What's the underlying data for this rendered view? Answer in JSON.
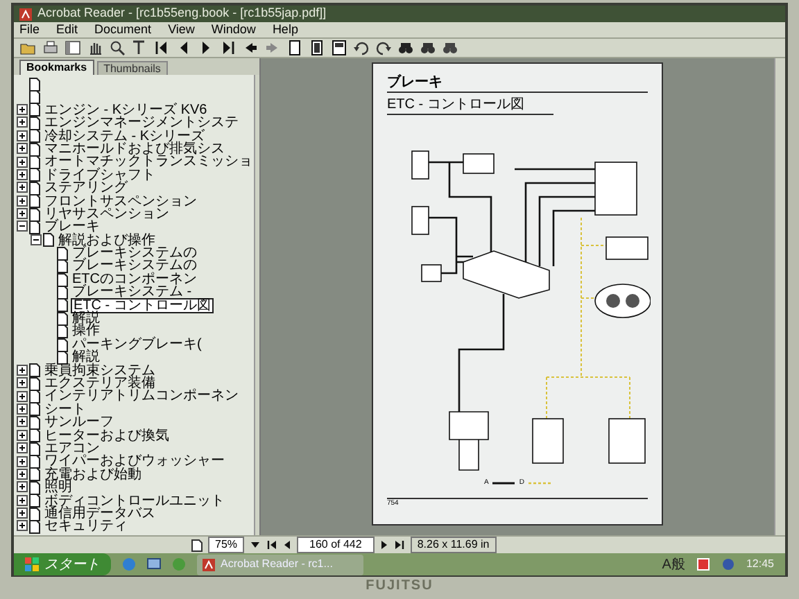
{
  "window": {
    "title": "Acrobat Reader - [rc1b55eng.book - [rc1b55jap.pdf]]"
  },
  "menu": [
    "File",
    "Edit",
    "Document",
    "View",
    "Window",
    "Help"
  ],
  "panel_tabs": [
    {
      "label": "Bookmarks",
      "selected": true
    },
    {
      "label": "Thumbnails",
      "selected": false
    }
  ],
  "bookmarks": [
    {
      "selected": false
    },
    {
      "selected": false
    },
    {
      "label": "エンジン - Kシリーズ KV6",
      "expanded": false,
      "selected": false
    },
    {
      "label": "エンジンマネージメントシステ",
      "expanded": false,
      "selected": false
    },
    {
      "label": "冷却システム - Kシリーズ",
      "expanded": false,
      "selected": false
    },
    {
      "label": "マニホールドおよび排気シス",
      "expanded": false,
      "selected": false
    },
    {
      "label": "オートマチックトランスミッショ",
      "expanded": false,
      "selected": false
    },
    {
      "label": "ドライブシャフト",
      "expanded": false,
      "selected": false
    },
    {
      "label": "ステアリング",
      "expanded": false,
      "selected": false
    },
    {
      "label": "フロントサスペンション",
      "expanded": false,
      "selected": false
    },
    {
      "label": "リヤサスペンション",
      "expanded": false,
      "selected": false
    },
    {
      "label": "ブレーキ",
      "expanded": true,
      "selected": false,
      "children": [
        {
          "label": "解説および操作",
          "expanded": true,
          "selected": false,
          "children": [
            {
              "label": "ブレーキシステムの",
              "selected": false
            },
            {
              "label": "ブレーキシステムの",
              "selected": false
            },
            {
              "label": "ETCのコンポーネン",
              "selected": false
            },
            {
              "label": "ブレーキシステム -",
              "selected": false
            },
            {
              "label": "ETC - コントロール図",
              "selected": true
            },
            {
              "label": "解説",
              "selected": false
            },
            {
              "label": "操作",
              "selected": false
            },
            {
              "label": "パーキングブレーキ(",
              "selected": false
            },
            {
              "label": "解説",
              "selected": false
            }
          ]
        }
      ]
    },
    {
      "label": "乗員拘束システム",
      "expanded": false,
      "selected": false
    },
    {
      "label": "エクステリア装備",
      "expanded": false,
      "selected": false
    },
    {
      "label": "インテリアトリムコンポーネン",
      "expanded": false,
      "selected": false
    },
    {
      "label": "シート",
      "expanded": false,
      "selected": false
    },
    {
      "label": "サンルーフ",
      "expanded": false,
      "selected": false
    },
    {
      "label": "ヒーターおよび換気",
      "expanded": false,
      "selected": false
    },
    {
      "label": "エアコン",
      "expanded": false,
      "selected": false
    },
    {
      "label": "ワイパーおよびウォッシャー",
      "expanded": false,
      "selected": false
    },
    {
      "label": "充電および始動",
      "expanded": false,
      "selected": false
    },
    {
      "label": "照明",
      "expanded": false,
      "selected": false
    },
    {
      "label": "ボディコントロールユニット",
      "expanded": false,
      "selected": false
    },
    {
      "label": "通信用データバス",
      "expanded": false,
      "selected": false
    },
    {
      "label": "セキュリティ",
      "expanded": false,
      "selected": false
    }
  ],
  "page": {
    "header": "ブレーキ",
    "subheader": "ETC - コントロール図",
    "legend": [
      "A",
      "D"
    ],
    "footer": "754"
  },
  "status_bar": {
    "zoom": "75%",
    "page_indicator": "160 of 442",
    "page_size": "8.26 x 11.69 in"
  },
  "taskbar": {
    "start": "スタート",
    "task": "Acrobat Reader - rc1...",
    "ime": "A般",
    "clock": "12:45"
  },
  "monitor": {
    "brand": "FUJITSU"
  }
}
